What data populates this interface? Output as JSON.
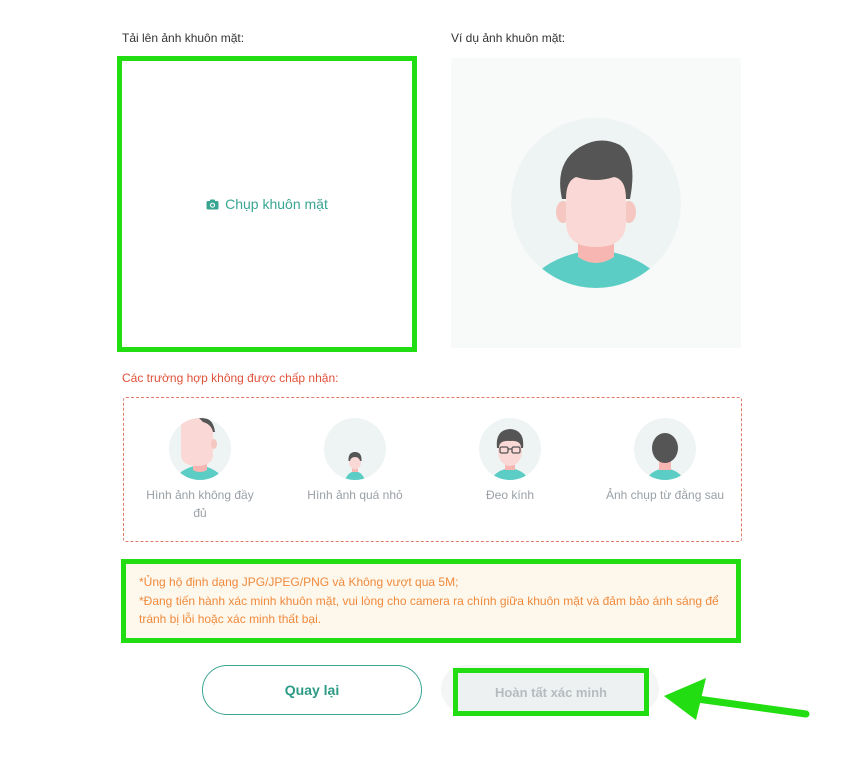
{
  "upload": {
    "label": "Tải lên ảnh khuôn mặt:",
    "capture_label": "Chụp khuôn mặt"
  },
  "example": {
    "label": "Ví dụ ảnh khuôn mặt:"
  },
  "rejected": {
    "title": "Các trường hợp không được chấp nhận:",
    "cases": [
      {
        "label": "Hình ảnh không đầy đủ"
      },
      {
        "label": "Hình ảnh quá nhỏ"
      },
      {
        "label": "Đeo kính"
      },
      {
        "label": "Ảnh chụp từ đằng sau"
      }
    ]
  },
  "notice": {
    "line1": "*Ủng hộ định dạng JPG/JPEG/PNG và Không vượt qua 5M;",
    "line2": "*Đang tiến hành xác minh khuôn mặt, vui lòng cho camera ra chính giữa khuôn mặt và đảm bảo ánh sáng để tránh bị lỗi hoặc xác minh thất bại."
  },
  "buttons": {
    "back": "Quay lại",
    "finish": "Hoàn tất xác minh"
  },
  "colors": {
    "accent": "#3aa592",
    "highlight": "#22dd11",
    "warning": "#f08a3c",
    "error": "#e0523a"
  }
}
